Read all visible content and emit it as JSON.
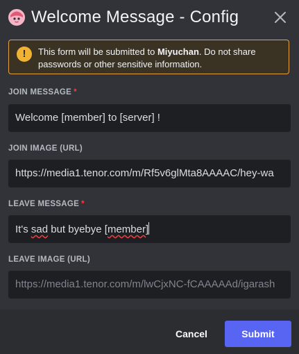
{
  "header": {
    "title": "Welcome Message - Config",
    "app_icon": "bot-avatar",
    "close_icon": "close-icon"
  },
  "warning": {
    "icon": "exclamation-icon",
    "text_before": "This form will be submitted to ",
    "app_name": "Miyuchan",
    "text_after": ". Do not share passwords or other sensitive information."
  },
  "fields": {
    "join_message": {
      "label": "JOIN MESSAGE",
      "required_mark": "*",
      "value": "Welcome [member] to [server] !"
    },
    "join_image": {
      "label": "JOIN IMAGE (URL)",
      "value": "https://media1.tenor.com/m/Rf5v6glMta8AAAAC/hey-wa"
    },
    "leave_message": {
      "label": "LEAVE MESSAGE",
      "required_mark": "*",
      "value_prefix": "It's ",
      "value_misspelled_1": "sad",
      "value_middle": " but byebye [",
      "value_misspelled_2": "member",
      "value_suffix": "]"
    },
    "leave_image": {
      "label": "LEAVE IMAGE (URL)",
      "placeholder": "https://media1.tenor.com/m/lwCjxNC-fCAAAAAd/igarash"
    }
  },
  "footer": {
    "cancel_label": "Cancel",
    "submit_label": "Submit"
  },
  "colors": {
    "background": "#313338",
    "footer": "#2b2d31",
    "input": "#1e1f22",
    "warning_border": "#e6a23c",
    "warning_icon": "#f0b232",
    "required": "#f23f42",
    "accent": "#5865f2"
  }
}
